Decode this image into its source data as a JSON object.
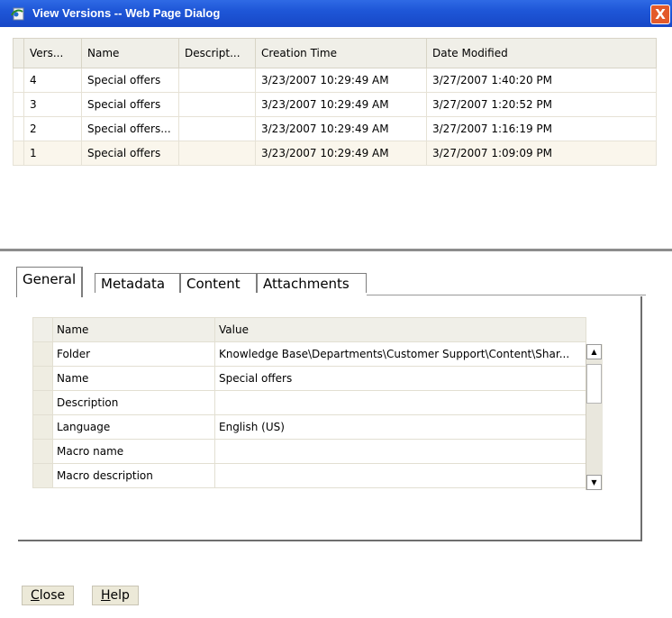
{
  "window": {
    "title": "View Versions -- Web Page Dialog",
    "close_glyph": "X",
    "icon": "ie-page-icon"
  },
  "versions": {
    "columns": [
      "Vers...",
      "Name",
      "Descript...",
      "Creation Time",
      "Date Modified"
    ],
    "rows": [
      {
        "version": "4",
        "name": "Special offers",
        "description": "",
        "created": "3/23/2007 10:29:49 AM",
        "modified": "3/27/2007 1:40:20 PM"
      },
      {
        "version": "3",
        "name": "Special offers",
        "description": "",
        "created": "3/23/2007 10:29:49 AM",
        "modified": "3/27/2007 1:20:52 PM"
      },
      {
        "version": "2",
        "name": "Special offers...",
        "description": "",
        "created": "3/23/2007 10:29:49 AM",
        "modified": "3/27/2007 1:16:19 PM"
      },
      {
        "version": "1",
        "name": "Special offers",
        "description": "",
        "created": "3/23/2007 10:29:49 AM",
        "modified": "3/27/2007 1:09:09 PM"
      }
    ],
    "selected_row": "1"
  },
  "tabs": [
    "General",
    "Metadata",
    "Content",
    "Attachments"
  ],
  "active_tab": "General",
  "properties": {
    "header": {
      "name": "Name",
      "value": "Value"
    },
    "rows": [
      {
        "name": "Folder",
        "value": "Knowledge Base\\Departments\\Customer Support\\Content\\Shar..."
      },
      {
        "name": "Name",
        "value": "Special offers"
      },
      {
        "name": "Description",
        "value": ""
      },
      {
        "name": "Language",
        "value": "English (US)"
      },
      {
        "name": "Macro name",
        "value": ""
      },
      {
        "name": "Macro description",
        "value": ""
      }
    ]
  },
  "buttons": {
    "close_u": "C",
    "close_rest": "lose",
    "help_u": "H",
    "help_rest": "elp"
  },
  "colors": {
    "titlebar": "#1e56d7",
    "close_button": "#e35a2b",
    "selected_row": "#faf6ec"
  }
}
